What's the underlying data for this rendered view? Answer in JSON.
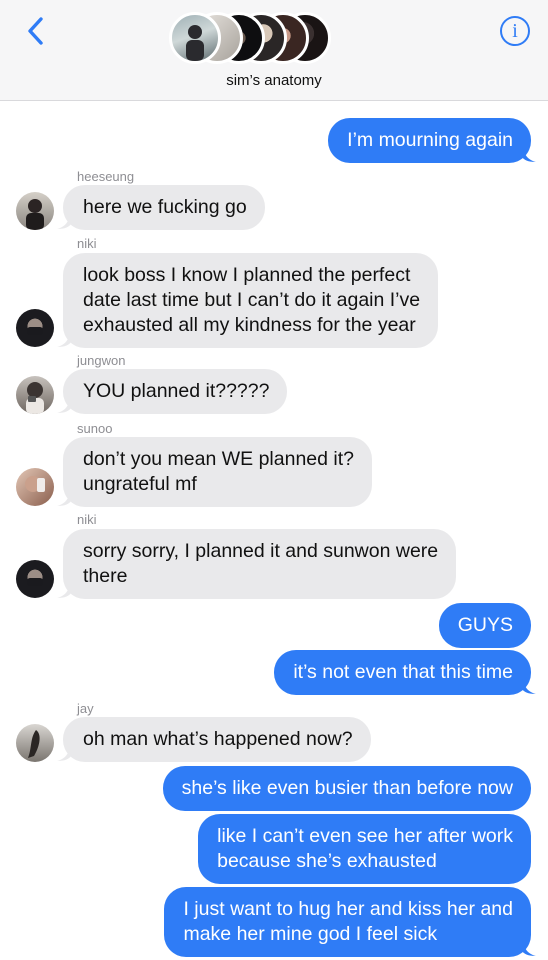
{
  "header": {
    "group_name": "sim’s anatomy",
    "back_icon": "chevron-left-icon",
    "info_icon": "info-icon",
    "info_glyph": "i",
    "accent_color": "#2f7cf6"
  },
  "messages": [
    {
      "type": "outgoing",
      "text": "I’m mourning again"
    },
    {
      "type": "incoming",
      "sender": "heeseung",
      "text": "here we fucking go"
    },
    {
      "type": "incoming",
      "sender": "niki",
      "lines": [
        "look boss I know I planned the perfect",
        "date last time but I can’t do it again I’ve",
        "exhausted all my kindness for the year"
      ]
    },
    {
      "type": "incoming",
      "sender": "jungwon",
      "text": "YOU planned it?????"
    },
    {
      "type": "incoming",
      "sender": "sunoo",
      "lines": [
        "don’t you mean WE planned it?",
        "ungrateful mf"
      ]
    },
    {
      "type": "incoming",
      "sender": "niki",
      "lines": [
        "sorry sorry, I planned it and sunwon were",
        "there"
      ]
    },
    {
      "type": "outgoing",
      "text": "GUYS"
    },
    {
      "type": "outgoing",
      "text": "it’s not even that this time"
    },
    {
      "type": "incoming",
      "sender": "jay",
      "text": "oh man what’s happened now?"
    },
    {
      "type": "outgoing",
      "text": "she’s like even busier than before now"
    },
    {
      "type": "outgoing",
      "lines": [
        "like I can’t even see her after work",
        "because she’s exhausted"
      ]
    },
    {
      "type": "outgoing",
      "lines": [
        "I just want to hug her and kiss her and",
        "make her mine god I feel sick"
      ]
    }
  ]
}
